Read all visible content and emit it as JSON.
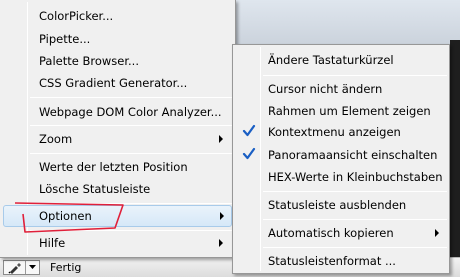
{
  "status_bar": {
    "text": "Fertig",
    "picker_icon": "eyedropper-icon",
    "dropdown_icon": "chevron-down-icon"
  },
  "main_menu": {
    "items": [
      {
        "label": "ColorPicker..."
      },
      {
        "label": "Pipette..."
      },
      {
        "label": "Palette Browser..."
      },
      {
        "label": "CSS Gradient Generator..."
      },
      {
        "label": "Webpage DOM Color Analyzer..."
      },
      {
        "label": "Zoom"
      },
      {
        "label": "Werte der letzten Position"
      },
      {
        "label": "Lösche Statusleiste"
      },
      {
        "label": "Optionen"
      },
      {
        "label": "Hilfe"
      }
    ]
  },
  "options_submenu": {
    "items": [
      {
        "label": "Ändere Tastaturkürzel"
      },
      {
        "label": "Cursor nicht ändern"
      },
      {
        "label": "Rahmen um Element zeigen"
      },
      {
        "label": "Kontextmenu anzeigen",
        "checked": true
      },
      {
        "label": "Panoramaansicht einschalten",
        "checked": true
      },
      {
        "label": "HEX-Werte in Kleinbuchstaben"
      },
      {
        "label": "Statusleiste ausblenden"
      },
      {
        "label": "Automatisch kopieren"
      },
      {
        "label": "Statusleistenformat ..."
      }
    ]
  },
  "colors": {
    "menu_bg": "#f0f0f0",
    "highlight": "#d6e8f8",
    "check_blue": "#1a5fc4",
    "annotation_red": "#e0203a"
  }
}
